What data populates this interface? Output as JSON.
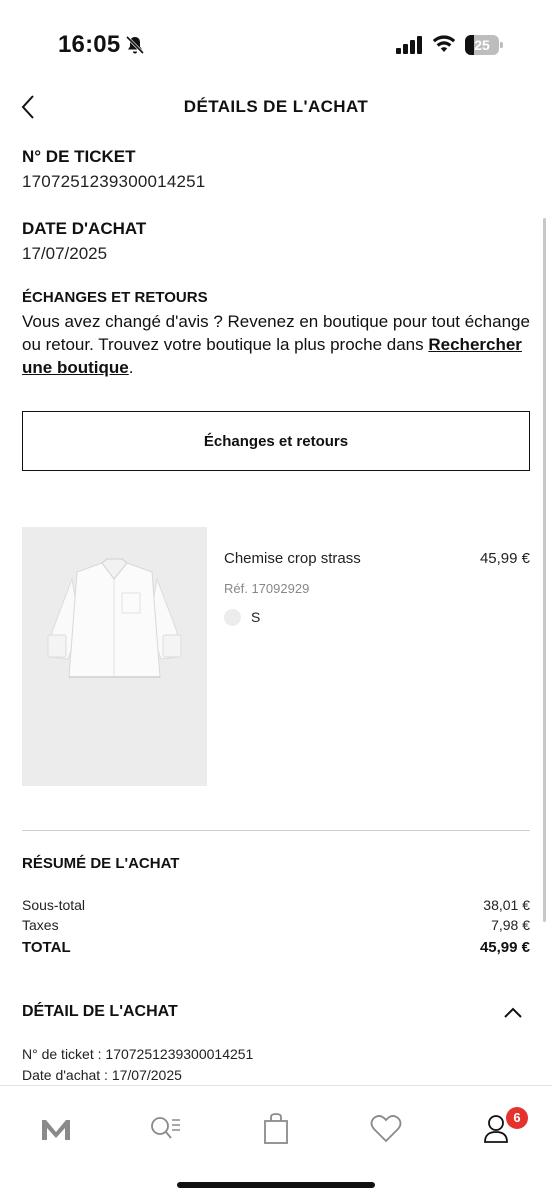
{
  "status_bar": {
    "time": "16:05",
    "battery_level": "25",
    "icons": [
      "bell-slash-icon",
      "cellular-signal-icon",
      "wifi-icon",
      "battery-icon"
    ]
  },
  "header": {
    "title": "DÉTAILS DE L'ACHAT",
    "back_icon": "chevron-left-icon"
  },
  "ticket": {
    "label": "N° DE TICKET",
    "value": "1707251239300014251"
  },
  "purchase_date": {
    "label": "DATE D'ACHAT",
    "value": "17/07/2025"
  },
  "exchanges": {
    "title": "ÉCHANGES ET RETOURS",
    "text": "Vous avez changé d'avis ? Revenez en boutique pour tout échange ou retour. Trouvez votre boutique la plus proche dans ",
    "link": "Rechercher une boutique",
    "suffix": ".",
    "button_label": "Échanges et retours"
  },
  "product": {
    "name": "Chemise crop strass",
    "price": "45,99 €",
    "ref": "Réf. 17092929",
    "size": "S",
    "image": "white-crop-shirt-image"
  },
  "summary": {
    "title": "RÉSUMÉ DE L'ACHAT",
    "subtotal_label": "Sous-total",
    "subtotal_value": "38,01 €",
    "taxes_label": "Taxes",
    "taxes_value": "7,98 €",
    "total_label": "TOTAL",
    "total_value": "45,99 €"
  },
  "detail": {
    "title": "DÉTAIL DE L'ACHAT",
    "ticket_line": "N° de ticket : 1707251239300014251",
    "date_line": "Date d'achat : 17/07/2025",
    "toggle_icon": "chevron-up-icon"
  },
  "bottom_nav": {
    "items": [
      "home-logo-icon",
      "search-icon",
      "shopping-bag-icon",
      "heart-icon",
      "user-icon"
    ],
    "badge": "6"
  },
  "colors": {
    "text": "#111111",
    "badge": "#e4332d",
    "image_bg": "#ececec"
  }
}
